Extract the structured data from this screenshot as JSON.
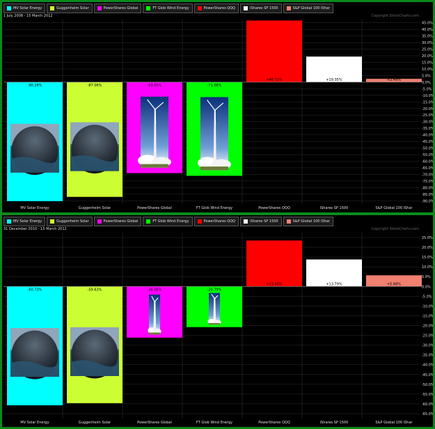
{
  "legend": [
    {
      "label": "MV Solar Energy",
      "color": "#00ffff"
    },
    {
      "label": "Guggenheim Solar",
      "color": "#ccff33"
    },
    {
      "label": "PowerShares Global",
      "color": "#ff00ff"
    },
    {
      "label": "FT Glob Wind Energy",
      "color": "#00ff00"
    },
    {
      "label": "PowerShares QQQ",
      "color": "#ff0000"
    },
    {
      "label": "iShares SP 1500",
      "color": "#ffffff"
    },
    {
      "label": "S&P Global 100 iShar",
      "color": "#f08070"
    }
  ],
  "copyright": "Copyright StockCharts.com",
  "chart_data": [
    {
      "type": "bar",
      "date_range": "1 July 2008 - 15 March 2012",
      "categories": [
        "MV Solar Energy",
        "Guggenheim Solar",
        "PowerShares Global",
        "FT Glob Wind Energy",
        "PowerShares QQQ",
        "iShares SP 1500",
        "S&P Global 100 iShar"
      ],
      "values": [
        -90.28,
        -87.06,
        -69.02,
        -71.08,
        46.72,
        19.35,
        2.49
      ],
      "value_labels": [
        "-90.28%",
        "-87.06%",
        "-69.02%",
        "-71.08%",
        "+46.72%",
        "+19.35%",
        "+2.49%"
      ],
      "ylim": [
        -92.5,
        47.5
      ],
      "y_ticks": [
        "45.0%",
        "40.0%",
        "35.0%",
        "30.0%",
        "25.0%",
        "20.0%",
        "15.0%",
        "10.0%",
        "5.0%",
        "0.0%",
        "-5.0%",
        "-10.0%",
        "-15.0%",
        "-20.0%",
        "-25.0%",
        "-30.0%",
        "-35.0%",
        "-40.0%",
        "-45.0%",
        "-50.0%",
        "-55.0%",
        "-60.0%",
        "-65.0%",
        "-70.0%",
        "-75.0%",
        "-80.0%",
        "-85.0%",
        "-90.0%"
      ],
      "y_tick_values": [
        45,
        40,
        35,
        30,
        25,
        20,
        15,
        10,
        5,
        0,
        -5,
        -10,
        -15,
        -20,
        -25,
        -30,
        -35,
        -40,
        -45,
        -50,
        -55,
        -60,
        -65,
        -70,
        -75,
        -80,
        -85,
        -90
      ],
      "grid": true,
      "images": [
        "solar",
        "solar",
        "wind",
        "wind",
        "",
        "",
        ""
      ]
    },
    {
      "type": "bar",
      "date_range": "31 December 2010 - 15 March 2012",
      "categories": [
        "MV Solar Energy",
        "Guggenheim Solar",
        "PowerShares Global",
        "FT Glob Wind Energy",
        "PowerShares QQQ",
        "iShares SP 1500",
        "S&P Global 100 iShar"
      ],
      "values": [
        -60.73,
        -59.63,
        -26.16,
        -20.79,
        23.46,
        13.79,
        5.68
      ],
      "value_labels": [
        "-60.73%",
        "-59.63%",
        "-26.16%",
        "-20.79%",
        "+23.46%",
        "+13.79%",
        "+5.68%"
      ],
      "ylim": [
        -67.5,
        27.5
      ],
      "y_ticks": [
        "25.0%",
        "20.0%",
        "15.0%",
        "10.0%",
        "5.0%",
        "0.0%",
        "-5.0%",
        "-10.0%",
        "-15.0%",
        "-20.0%",
        "-25.0%",
        "-30.0%",
        "-35.0%",
        "-40.0%",
        "-45.0%",
        "-50.0%",
        "-55.0%",
        "-60.0%",
        "-65.0%"
      ],
      "y_tick_values": [
        25,
        20,
        15,
        10,
        5,
        0,
        -5,
        -10,
        -15,
        -20,
        -25,
        -30,
        -35,
        -40,
        -45,
        -50,
        -55,
        -60,
        -65
      ],
      "grid": true,
      "images": [
        "solar",
        "solar",
        "wind",
        "wind",
        "",
        "",
        ""
      ]
    }
  ]
}
